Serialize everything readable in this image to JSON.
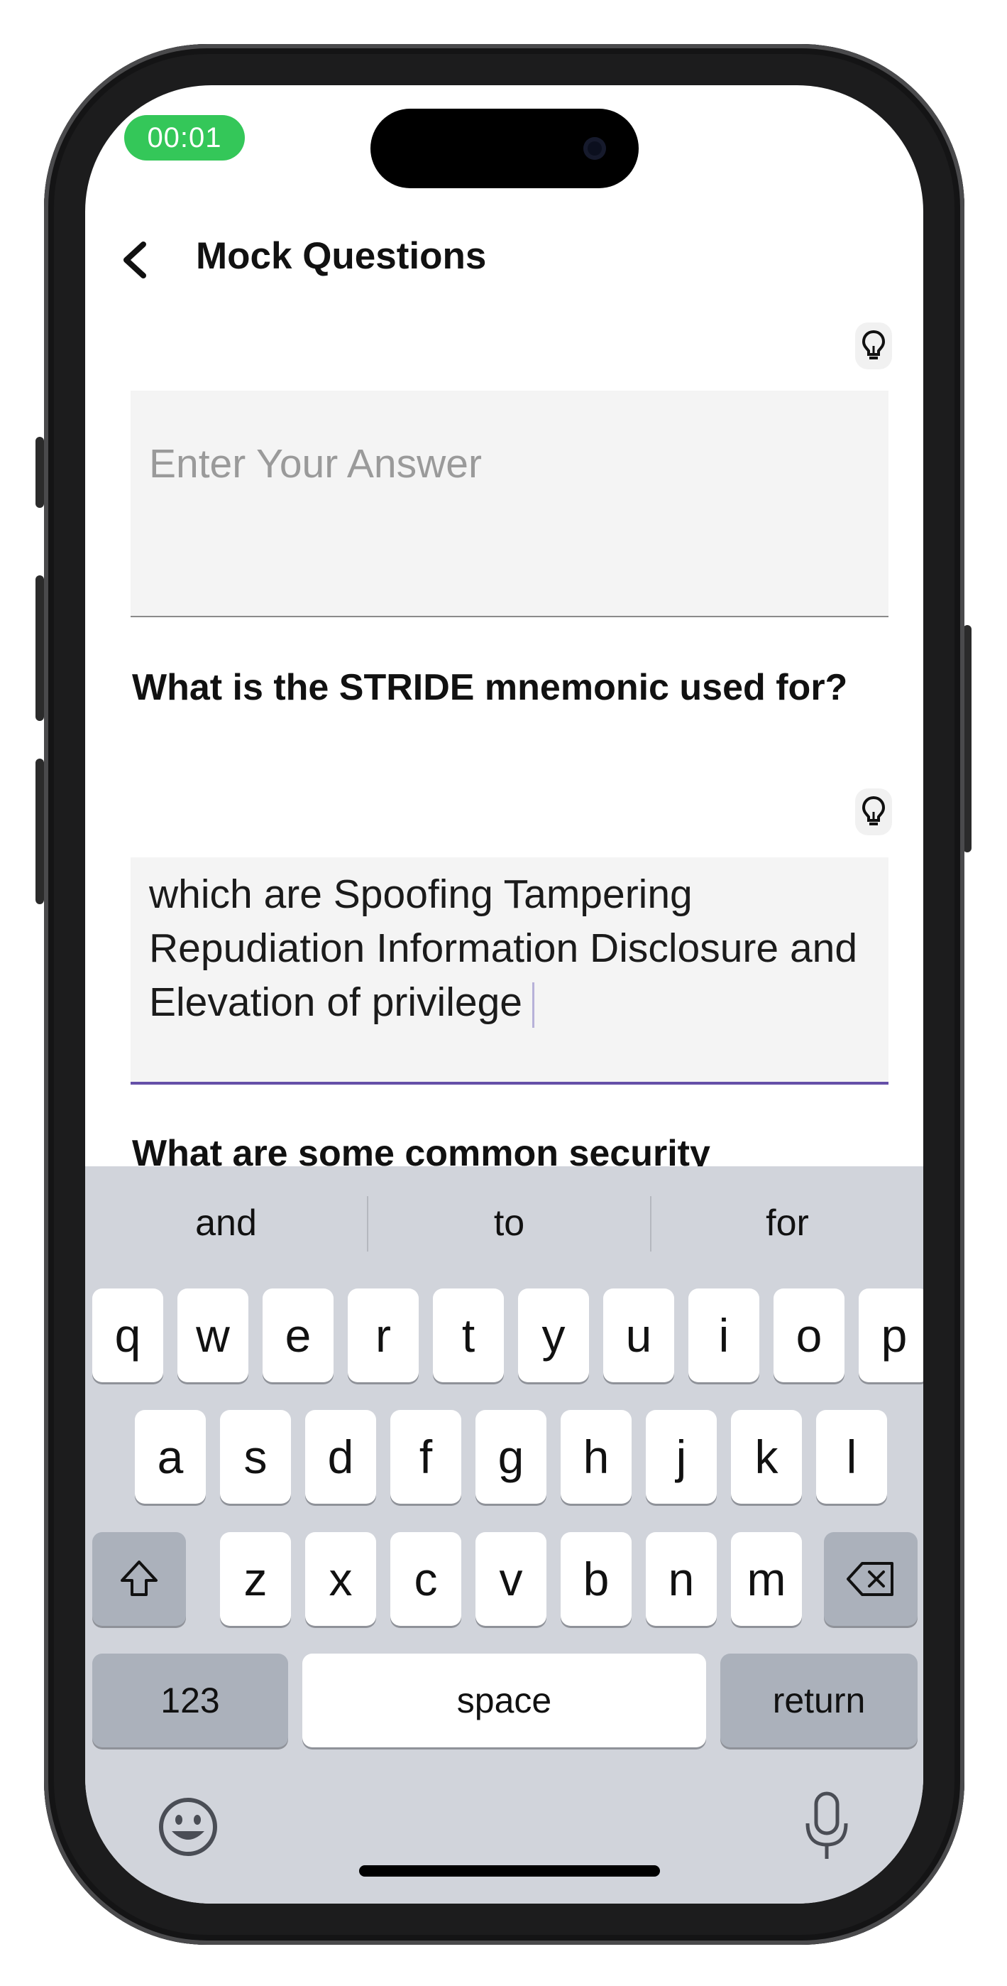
{
  "status_bar": {
    "timer": "00:01"
  },
  "nav": {
    "title": "Mock Questions"
  },
  "questions": [
    {
      "question": "",
      "answer_value": "",
      "answer_placeholder": "Enter Your Answer"
    },
    {
      "question": "What is the STRIDE mnemonic used for?",
      "answer_value": "which are Spoofing Tampering Repudiation Information Disclosure and Elevation of privilege",
      "answer_placeholder": ""
    },
    {
      "question": "What are some common security"
    }
  ],
  "keyboard": {
    "suggestions": [
      "and",
      "to",
      "for"
    ],
    "row1": [
      "q",
      "w",
      "e",
      "r",
      "t",
      "y",
      "u",
      "i",
      "o",
      "p"
    ],
    "row2": [
      "a",
      "s",
      "d",
      "f",
      "g",
      "h",
      "j",
      "k",
      "l"
    ],
    "row3": [
      "z",
      "x",
      "c",
      "v",
      "b",
      "n",
      "m"
    ],
    "numbers_label": "123",
    "space_label": "space",
    "return_label": "return"
  },
  "colors": {
    "timer_green": "#34c759",
    "focus_underline": "#6550a8",
    "keyboard_bg": "#d1d4db"
  }
}
